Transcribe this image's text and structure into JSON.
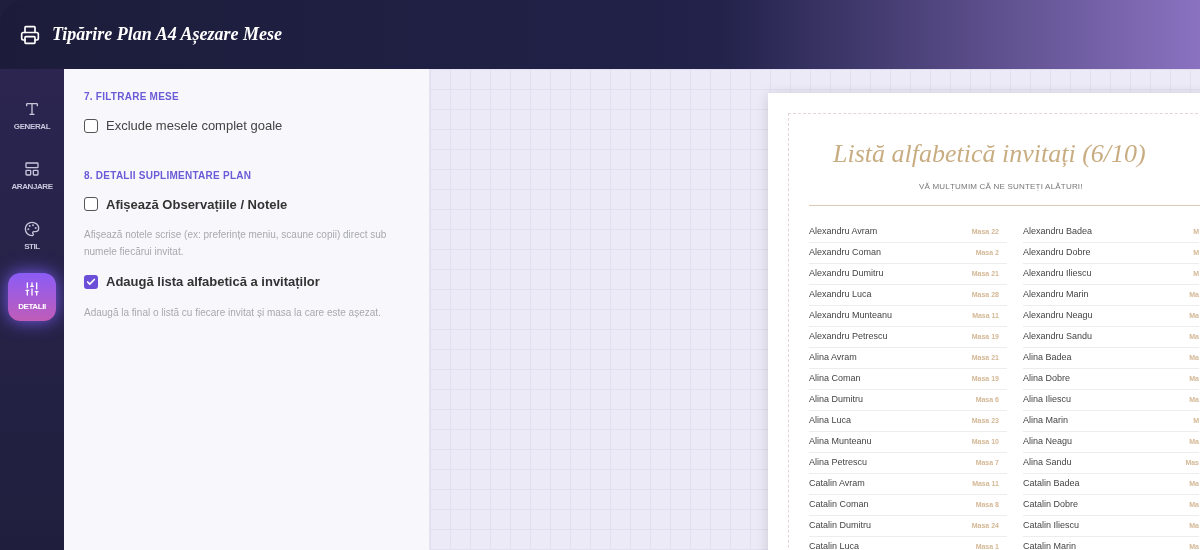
{
  "header": {
    "title": "Tipărire Plan A4 Așezare Mese"
  },
  "sidebar": {
    "items": [
      {
        "label": "GENERAL",
        "kind": "text",
        "selected": false
      },
      {
        "label": "ARANJARE",
        "kind": "layout",
        "selected": false
      },
      {
        "label": "STIL",
        "kind": "palette",
        "selected": false
      },
      {
        "label": "DETALII",
        "kind": "sliders",
        "selected": true
      }
    ]
  },
  "settings": {
    "sections": [
      {
        "title": "7. FILTRARE MESE",
        "options": [
          {
            "label": "Exclude mesele complet goale",
            "checked": false,
            "bold": false
          }
        ]
      },
      {
        "title": "8. DETALII SUPLIMENTARE PLAN",
        "options": [
          {
            "label": "Afișează Observațiile / Notele",
            "checked": false,
            "bold": true,
            "hint": "Afișează notele scrise (ex: preferințe meniu, scaune copii) direct sub numele fiecărui invitat."
          },
          {
            "label": "Adaugă lista alfabetică a invitaților",
            "checked": true,
            "bold": true,
            "hint": "Adaugă la final o listă cu fiecare invitat și masa la care este așezat."
          }
        ]
      }
    ]
  },
  "preview": {
    "title": "Listă alfabetică invitați (6/10)",
    "subtitle": "VĂ MULȚUMIM CĂ NE SUNTEȚI ALĂTURI!",
    "rows": [
      {
        "left_name": "Alexandru Avram",
        "left_table": "Masa 22",
        "right_name": "Alexandru Badea",
        "right_table": "M"
      },
      {
        "left_name": "Alexandru Coman",
        "left_table": "Masa 2",
        "right_name": "Alexandru Dobre",
        "right_table": "M"
      },
      {
        "left_name": "Alexandru Dumitru",
        "left_table": "Masa 21",
        "right_name": "Alexandru Iliescu",
        "right_table": "M"
      },
      {
        "left_name": "Alexandru Luca",
        "left_table": "Masa 28",
        "right_name": "Alexandru Marin",
        "right_table": "Ma"
      },
      {
        "left_name": "Alexandru Munteanu",
        "left_table": "Masa 11",
        "right_name": "Alexandru Neagu",
        "right_table": "Ma"
      },
      {
        "left_name": "Alexandru Petrescu",
        "left_table": "Masa 19",
        "right_name": "Alexandru Sandu",
        "right_table": "Ma"
      },
      {
        "left_name": "Alina Avram",
        "left_table": "Masa 21",
        "right_name": "Alina Badea",
        "right_table": "Ma"
      },
      {
        "left_name": "Alina Coman",
        "left_table": "Masa 19",
        "right_name": "Alina Dobre",
        "right_table": "Ma"
      },
      {
        "left_name": "Alina Dumitru",
        "left_table": "Masa 6",
        "right_name": "Alina Iliescu",
        "right_table": "Ma"
      },
      {
        "left_name": "Alina Luca",
        "left_table": "Masa 23",
        "right_name": "Alina Marin",
        "right_table": "M"
      },
      {
        "left_name": "Alina Munteanu",
        "left_table": "Masa 10",
        "right_name": "Alina Neagu",
        "right_table": "Ma"
      },
      {
        "left_name": "Alina Petrescu",
        "left_table": "Masa 7",
        "right_name": "Alina Sandu",
        "right_table": "Mas"
      },
      {
        "left_name": "Catalin Avram",
        "left_table": "Masa 11",
        "right_name": "Catalin Badea",
        "right_table": "Ma"
      },
      {
        "left_name": "Catalin Coman",
        "left_table": "Masa 8",
        "right_name": "Catalin Dobre",
        "right_table": "Ma"
      },
      {
        "left_name": "Catalin Dumitru",
        "left_table": "Masa 24",
        "right_name": "Catalin Iliescu",
        "right_table": "Ma"
      },
      {
        "left_name": "Catalin Luca",
        "left_table": "Masa 1",
        "right_name": "Catalin Marin",
        "right_table": "Ma"
      }
    ]
  }
}
